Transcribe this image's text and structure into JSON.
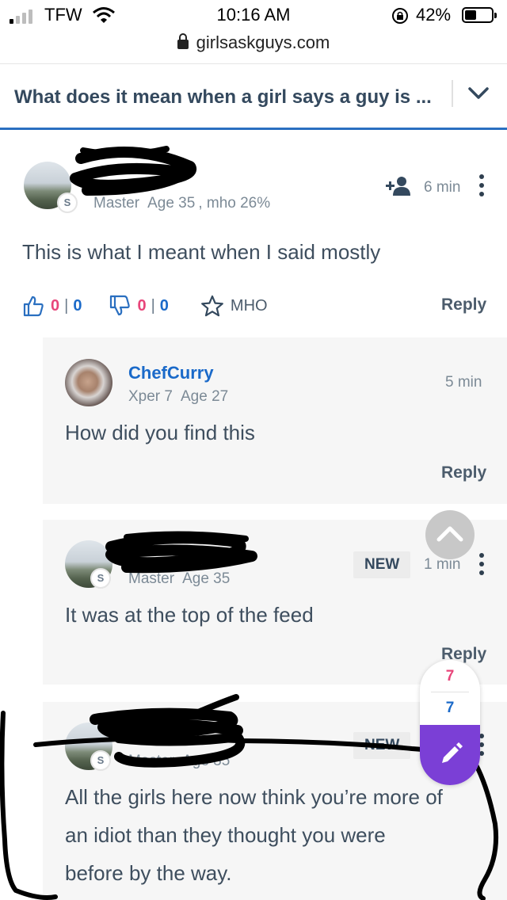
{
  "status_bar": {
    "carrier": "TFW",
    "time": "10:16 AM",
    "battery": "42%",
    "url": "girlsaskguys.com"
  },
  "question": {
    "title": "What does it mean when a girl says a guy is ..."
  },
  "main_comment": {
    "username": "",
    "badge": "S",
    "rank": "Master",
    "age": "Age 35",
    "mho": ", mho 26%",
    "time": "6 min",
    "text": "This is what I meant when I said mostly",
    "likes": "0",
    "likes_total": "0",
    "dislikes": "0",
    "dislikes_total": "0",
    "mho_label": "MHO",
    "reply_label": "Reply"
  },
  "replies": [
    {
      "username": "ChefCurry",
      "rank": "Xper 7",
      "age": "Age 27",
      "time": "5 min",
      "text": "How did you find this",
      "reply_label": "Reply"
    },
    {
      "username": "",
      "badge": "S",
      "rank": "Master",
      "age": "Age 35",
      "new_label": "NEW",
      "time": "1 min",
      "text": "It was at the top of the feed",
      "reply_label": "Reply"
    },
    {
      "username": "",
      "badge": "S",
      "rank": "Master",
      "age": "Age 35",
      "new_label": "NEW",
      "text_line1": "All the girls here now think you’re more of",
      "text_line2": "an idiot than they thought you were",
      "text_line3": "before by the way."
    }
  ],
  "floating": {
    "count_pink": "7",
    "count_blue": "7"
  },
  "colors": {
    "accent_blue": "#1b6ac9",
    "pink": "#e8457a",
    "purple": "#7b3fd6"
  }
}
